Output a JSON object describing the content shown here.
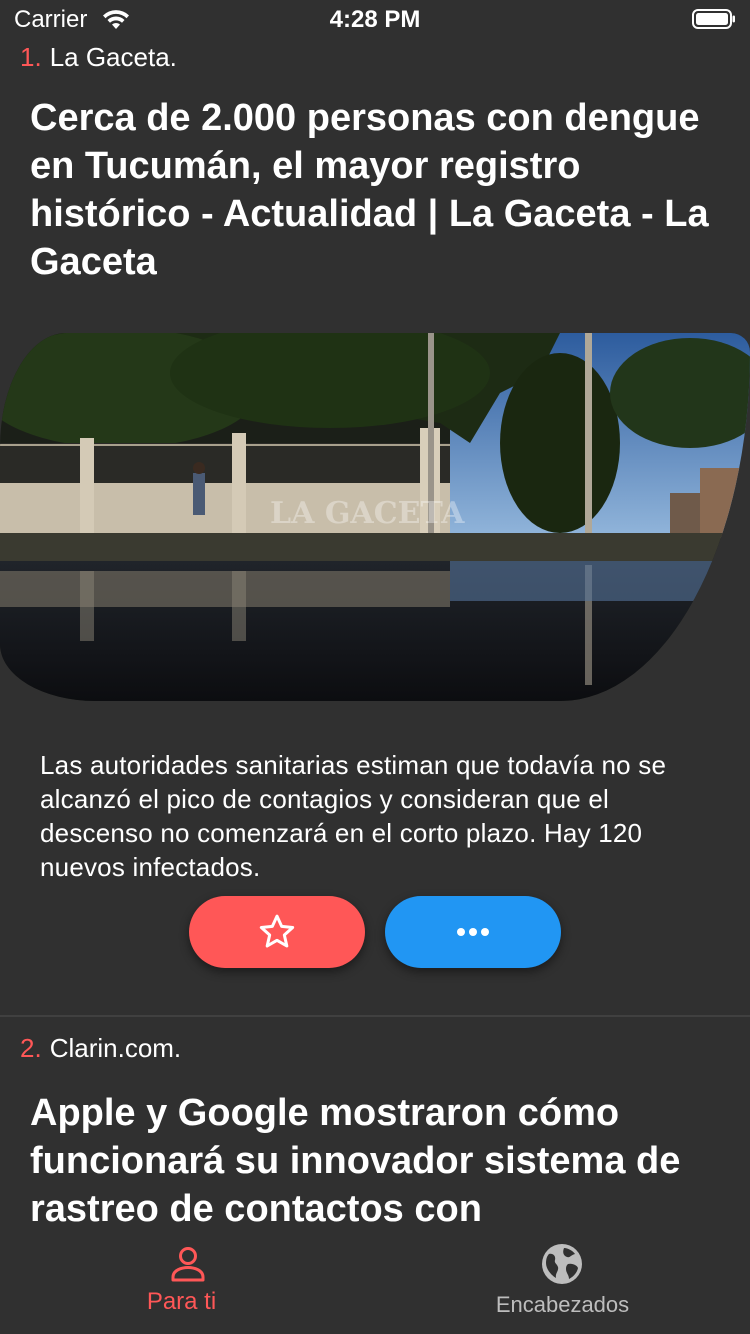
{
  "status_bar": {
    "carrier": "Carrier",
    "time": "4:28 PM"
  },
  "articles": [
    {
      "number": "1.",
      "source": "La Gaceta.",
      "headline": "Cerca de 2.000 personas con dengue en Tucumán, el mayor registro histórico - Actualidad | La Gaceta - La Gaceta",
      "image_watermark": "LA GACETA",
      "summary": "Las autoridades sanitarias estiman que todavía no se alcanzó el pico de contagios y consideran que el descenso no comenzará en el corto plazo. Hay 120 nuevos infectados.",
      "actions": [
        {
          "icon": "star-outline-icon",
          "color": "#ff5757"
        },
        {
          "icon": "more-dots-icon",
          "color": "#2196f3"
        }
      ]
    },
    {
      "number": "2.",
      "source": "Clarin.com.",
      "headline": "Apple y Google mostraron cómo funcionará su innovador sistema de rastreo de contactos con"
    }
  ],
  "tab_bar": {
    "tabs": [
      {
        "label": "Para ti",
        "icon": "person-icon",
        "active": true,
        "color": "#ff5757"
      },
      {
        "label": "Encabezados",
        "icon": "globe-icon",
        "active": false,
        "color": "#bdbdbd"
      }
    ]
  },
  "colors": {
    "background": "#303030",
    "accent": "#ff5757",
    "secondary_button": "#2196f3"
  }
}
